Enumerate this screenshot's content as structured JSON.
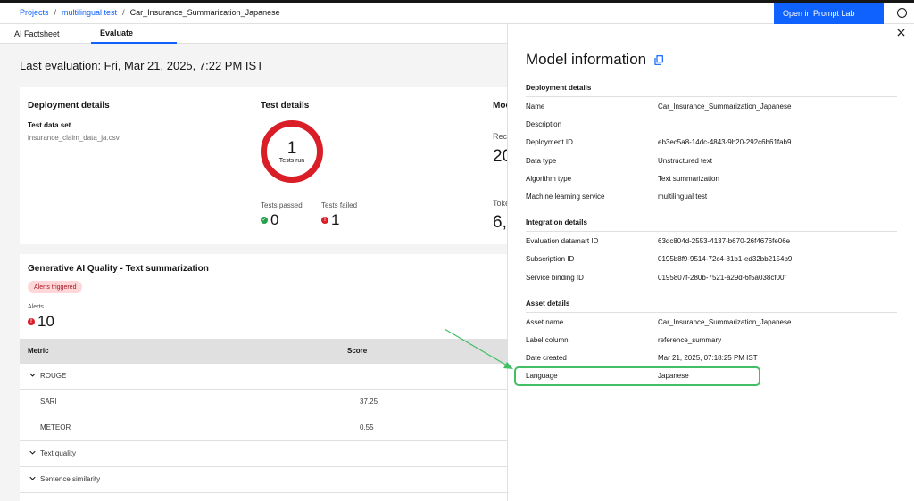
{
  "breadcrumb": {
    "items": [
      "Projects",
      "multilingual test"
    ],
    "current": "Car_Insurance_Summarization_Japanese"
  },
  "header": {
    "prompt_lab_label": "Open in Prompt Lab"
  },
  "tabs": [
    {
      "label": "AI Factsheet"
    },
    {
      "label": "Evaluate"
    }
  ],
  "evaluation": {
    "last_evaluation": "Last evaluation: Fri, Mar 21, 2025, 7:22 PM IST"
  },
  "deployment_card": {
    "deployment_details_title": "Deployment details",
    "test_data_set_label": "Test data set",
    "test_data_set_value": "insurance_claim_data_ja.csv",
    "test_details_title": "Test details",
    "tests_run_value": "1",
    "tests_run_label": "Tests run",
    "tests_passed_label": "Tests passed",
    "tests_passed_value": "0",
    "tests_failed_label": "Tests failed",
    "tests_failed_value": "1",
    "clipped_title": "Moc",
    "clipped_rec_label": "Rec",
    "clipped_rec_value": "20",
    "clipped_tok_label": "Toke",
    "clipped_tok_value": "6,"
  },
  "quality_card": {
    "title": "Generative AI Quality - Text summarization",
    "alert_tag": "Alerts triggered",
    "alerts_label": "Alerts",
    "alerts_value": "10",
    "columns": [
      "Metric",
      "Score"
    ],
    "rows": [
      {
        "metric": "ROUGE",
        "score": "",
        "group": true
      },
      {
        "metric": "SARI",
        "score": "37.25",
        "group": false
      },
      {
        "metric": "METEOR",
        "score": "0.55",
        "group": false
      },
      {
        "metric": "Text quality",
        "score": "",
        "group": true
      },
      {
        "metric": "Sentence similarity",
        "score": "",
        "group": true
      }
    ]
  },
  "model_info": {
    "title": "Model information",
    "sections": [
      {
        "title": "Deployment details",
        "rows": [
          {
            "key": "Name",
            "value": "Car_Insurance_Summarization_Japanese"
          },
          {
            "key": "Description",
            "value": ""
          },
          {
            "key": "Deployment ID",
            "value": "eb3ec5a8-14dc-4843-9b20-292c6b61fab9"
          },
          {
            "key": "Data type",
            "value": "Unstructured text"
          },
          {
            "key": "Algorithm type",
            "value": "Text summarization"
          },
          {
            "key": "Machine learning service",
            "value": "multilingual test"
          }
        ]
      },
      {
        "title": "Integration details",
        "rows": [
          {
            "key": "Evaluation datamart ID",
            "value": "63dc804d-2553-4137-b670-26f4676fe06e"
          },
          {
            "key": "Subscription ID",
            "value": "0195b8f9-9514-72c4-81b1-ed32bb2154b9"
          },
          {
            "key": "Service binding ID",
            "value": "0195807f-280b-7521-a29d-6f5a038cf00f"
          }
        ]
      },
      {
        "title": "Asset details",
        "rows": [
          {
            "key": "Asset name",
            "value": "Car_Insurance_Summarization_Japanese"
          },
          {
            "key": "Label column",
            "value": "reference_summary"
          },
          {
            "key": "Date created",
            "value": "Mar 21, 2025, 07:18:25 PM IST"
          },
          {
            "key": "Language",
            "value": "Japanese"
          }
        ]
      }
    ]
  },
  "colors": {
    "accent": "#0f62fe",
    "alert_red": "#da1e28",
    "success_green": "#24a148",
    "highlight_green": "#42be65"
  },
  "icons": [
    "copy-icon",
    "close-icon",
    "info-icon",
    "chevron-down-icon",
    "check-icon",
    "warning-icon",
    "arrow-annotation"
  ]
}
